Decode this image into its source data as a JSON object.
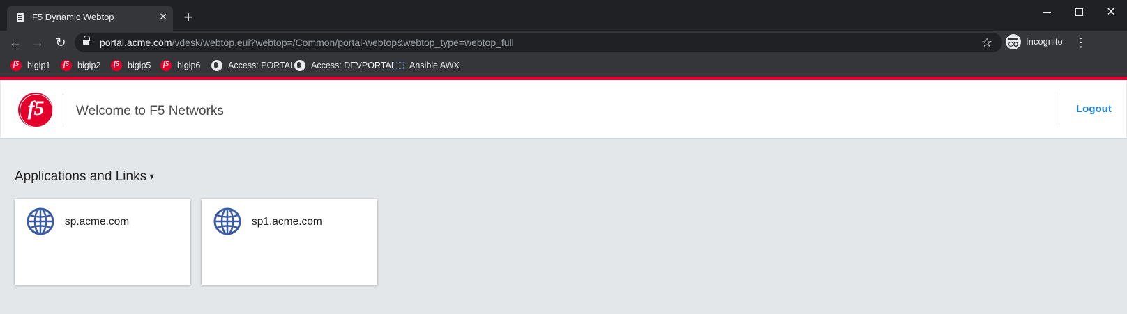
{
  "browser": {
    "tab": {
      "title": "F5 Dynamic Webtop",
      "favicon": "document-icon"
    },
    "url": {
      "host": "portal.acme.com",
      "path": "/vdesk/webtop.eui?webtop=/Common/portal-webtop&webtop_type=webtop_full"
    },
    "profile_label": "Incognito",
    "bookmarks": [
      {
        "label": "bigip1",
        "icon": "f5-icon"
      },
      {
        "label": "bigip2",
        "icon": "f5-icon"
      },
      {
        "label": "bigip5",
        "icon": "f5-icon"
      },
      {
        "label": "bigip6",
        "icon": "f5-icon"
      },
      {
        "label": "Access: PORTAL",
        "icon": "globe-icon"
      },
      {
        "label": "Access: DEVPORTAL",
        "icon": "globe-icon"
      },
      {
        "label": "Ansible AWX",
        "icon": "awx-icon"
      }
    ]
  },
  "header": {
    "welcome": "Welcome to F5 Networks",
    "logout_label": "Logout"
  },
  "main": {
    "section_title": "Applications and Links",
    "apps": [
      {
        "label": "sp.acme.com",
        "icon": "globe-icon"
      },
      {
        "label": "sp1.acme.com",
        "icon": "globe-icon"
      }
    ]
  },
  "colors": {
    "brand_red": "#e4002b",
    "link_blue": "#1e7fd1",
    "globe_blue": "#3b5aa8",
    "page_bg": "#e4e7ea"
  }
}
